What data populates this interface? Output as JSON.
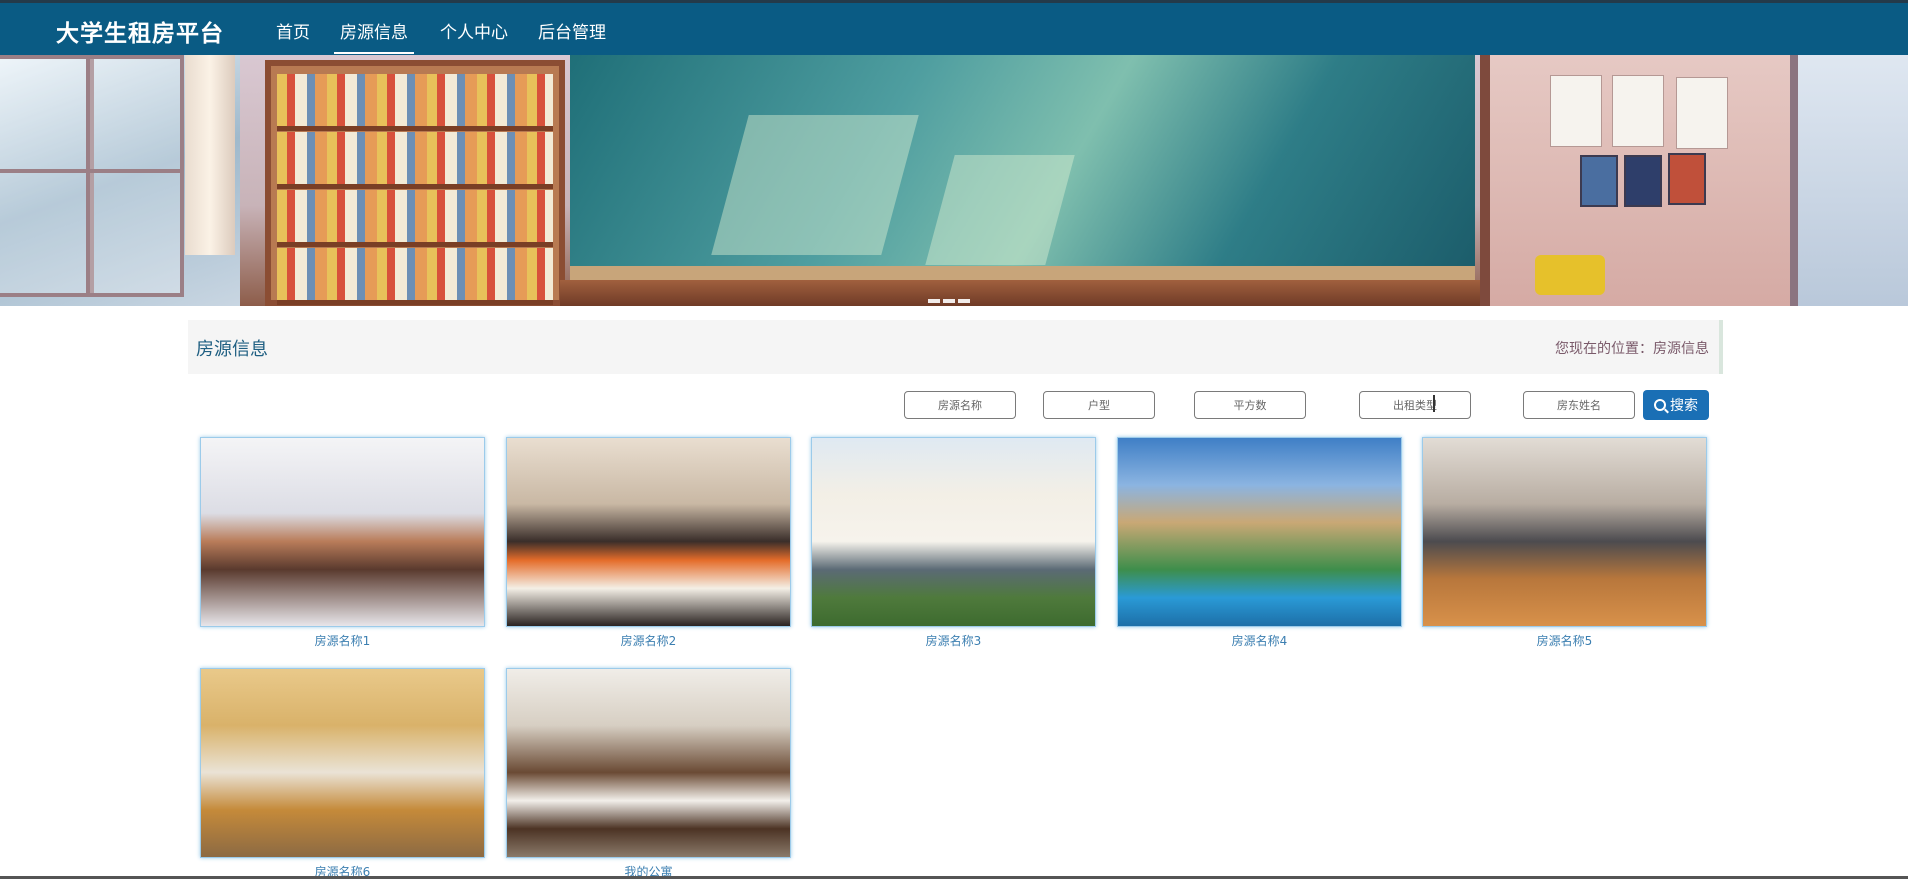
{
  "app": {
    "brand": "大学生租房平台"
  },
  "nav": {
    "items": [
      {
        "label": "首页",
        "active": false
      },
      {
        "label": "房源信息",
        "active": true
      },
      {
        "label": "个人中心",
        "active": false
      },
      {
        "label": "后台管理",
        "active": false
      }
    ]
  },
  "section": {
    "title": "房源信息",
    "breadcrumb": "您现在的位置：房源信息"
  },
  "search": {
    "fields": [
      {
        "placeholder": "房源名称"
      },
      {
        "placeholder": "户型"
      },
      {
        "placeholder": "平方数"
      },
      {
        "placeholder": "出租类型"
      },
      {
        "placeholder": "房东姓名"
      }
    ],
    "button_label": "搜索"
  },
  "listings": [
    {
      "name": "房源名称1"
    },
    {
      "name": "房源名称2"
    },
    {
      "name": "房源名称3"
    },
    {
      "name": "房源名称4"
    },
    {
      "name": "房源名称5"
    },
    {
      "name": "房源名称6"
    },
    {
      "name": "我的公寓"
    }
  ],
  "colors": {
    "topbar": "#0a5b84",
    "accent_button": "#1a6fb5",
    "caption_text": "#3c7fb1"
  }
}
